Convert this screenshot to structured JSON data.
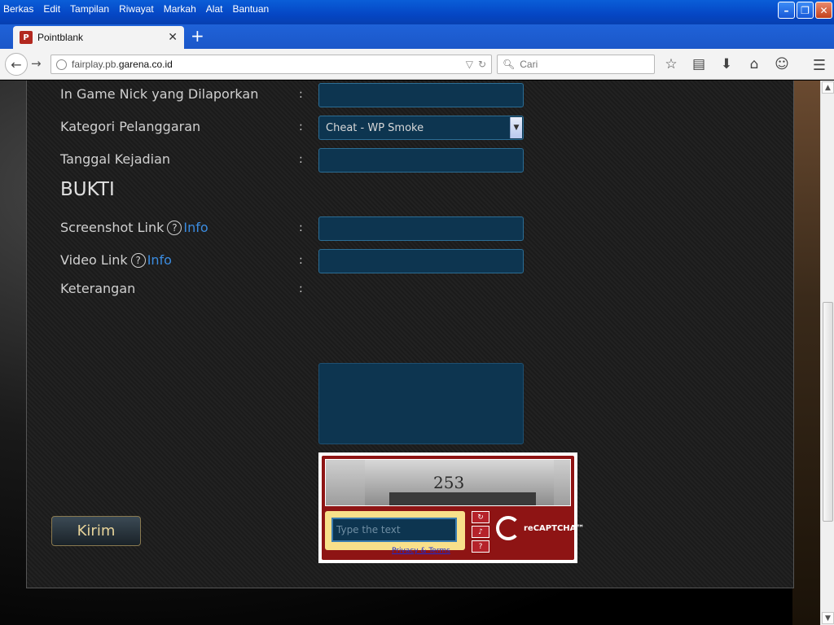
{
  "menu": [
    "Berkas",
    "Edit",
    "Tampilan",
    "Riwayat",
    "Markah",
    "Alat",
    "Bantuan"
  ],
  "window_buttons": {
    "minimize": "–",
    "maximize": "❐",
    "close": "✕"
  },
  "tab": {
    "title": "Pointblank",
    "close": "✕",
    "new_tab": "+"
  },
  "url": {
    "prefix": "fairplay.pb.",
    "domain": "garena.co.id"
  },
  "search": {
    "placeholder": "Cari"
  },
  "form": {
    "nick_label": "In Game Nick yang Dilaporkan",
    "category_label": "Kategori Pelanggaran",
    "category_value": "Cheat - WP Smoke",
    "date_label": "Tanggal Kejadian",
    "section_title": "BUKTI",
    "screenshot_label": "Screenshot Link",
    "video_label": "Video Link",
    "info_text": "Info",
    "help_glyph": "?",
    "notes_label": "Keterangan",
    "colon": ":"
  },
  "captcha": {
    "image_number": "253",
    "placeholder": "Type the text",
    "privacy": "Privacy & Terms",
    "brand": "reCAPTCHA™"
  },
  "submit_label": "Kirim"
}
